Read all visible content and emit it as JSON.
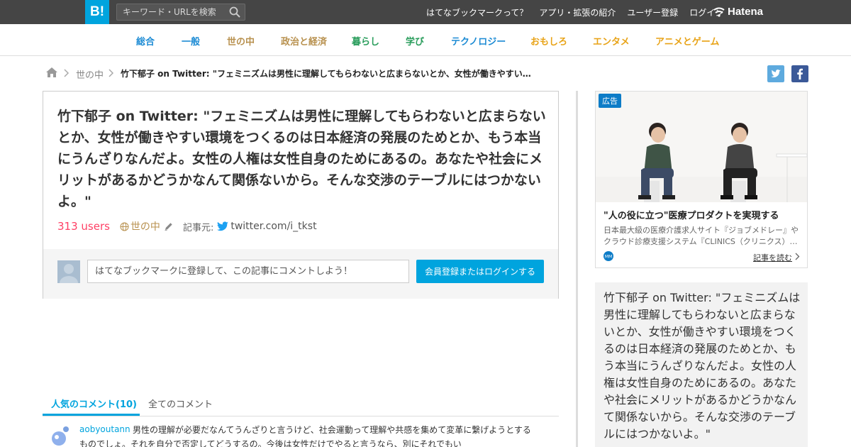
{
  "topbar": {
    "logo": "B!",
    "search_placeholder": "キーワード・URLを検索",
    "nav": [
      "はてなブックマークって？",
      "アプリ・拡張の紹介",
      "ユーザー登録",
      "ログイン"
    ],
    "brand": "Hatena"
  },
  "categories": [
    {
      "label": "総合",
      "color": "#1c8bd4"
    },
    {
      "label": "一般",
      "color": "#1c8bd4"
    },
    {
      "label": "世の中",
      "color": "#b8914f"
    },
    {
      "label": "政治と経済",
      "color": "#b8914f"
    },
    {
      "label": "暮らし",
      "color": "#2a9d5c"
    },
    {
      "label": "学び",
      "color": "#2a9d5c"
    },
    {
      "label": "テクノロジー",
      "color": "#1c8bd4"
    },
    {
      "label": "おもしろ",
      "color": "#e8a317"
    },
    {
      "label": "エンタメ",
      "color": "#e8a317"
    },
    {
      "label": "アニメとゲーム",
      "color": "#e8a317"
    }
  ],
  "breadcrumb": {
    "category": "世の中",
    "title": "竹下郁子 on Twitter: \"フェミニズムは男性に理解してもらわないと広まらないとか、女性が働きやすい環境…"
  },
  "entry": {
    "title": "竹下郁子 on Twitter: \"フェミニズムは男性に理解してもらわないと広まらないとか、女性が働きやすい環境をつくるのは日本経済の発展のためとか、もう本当にうんざりなんだよ。女性の人権は女性自身のためにあるの。あなたや社会にメリットがあるかどうかなんて関係ないから。そんな交渉のテーブルにはつかないよ。\"",
    "users": "313 users",
    "category": "世の中",
    "source_label": "記事元:",
    "source": "twitter.com/i_tkst",
    "comment_placeholder": "はてなブックマークに登録して、この記事にコメントしよう！",
    "login_button": "会員登録またはログインする"
  },
  "tabs": {
    "popular": "人気のコメント(10)",
    "all": "全てのコメント"
  },
  "comment": {
    "user": "aobyoutann",
    "text": "男性の理解が必要だなんてうんざりと言うけど、社会運動って理解や共感を集めて変革に繋げようとするものでしょ。それを自分で否定してどうするの。今後は女性だけでやると言うなら、別にそれでもい"
  },
  "ad": {
    "label": "広告",
    "title": "\"人の役に立つ\"医療プロダクトを実現する",
    "description": "日本最大級の医療介護求人サイト『ジョブメドレー』やクラウド診療支援システム『CLINICS（クリニクス）…",
    "brand_mark": "MM",
    "link": "記事を読む"
  },
  "sidebar_quote": "竹下郁子 on Twitter: \"フェミニズムは男性に理解してもらわないと広まらないとか、女性が働きやすい環境をつくるのは日本経済の発展のためとか、もう本当にうんざりなんだよ。女性の人権は女性自身のためにあるの。あなたや社会にメリットがあるかどうかなんて関係ないから。そんな交渉のテーブルにはつかないよ。\"",
  "colors": {
    "accent": "#00a4de",
    "users": "#ff4166",
    "topbar": "#454545",
    "twitter": "#1da1f2",
    "facebook": "#3b5998"
  }
}
